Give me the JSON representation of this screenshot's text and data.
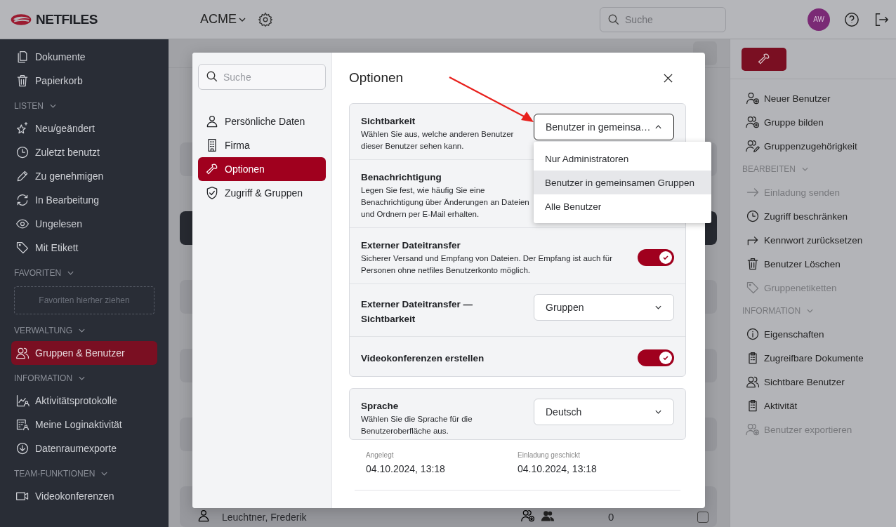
{
  "header": {
    "logo": "NETFILES",
    "workspace": "ACME",
    "search_placeholder": "Suche",
    "avatar": "AW"
  },
  "sidebar": {
    "top_items": [
      {
        "label": "Dokumente",
        "selected": false
      },
      {
        "label": "Papierkorb",
        "selected": false
      }
    ],
    "sections": [
      {
        "title": "LISTEN",
        "items": [
          {
            "label": "Neu/geändert",
            "selected": false
          },
          {
            "label": "Zuletzt benutzt",
            "selected": false
          },
          {
            "label": "Zu genehmigen",
            "selected": false
          },
          {
            "label": "In Bearbeitung",
            "selected": false
          },
          {
            "label": "Ungelesen",
            "selected": false
          },
          {
            "label": "Mit Etikett",
            "selected": false
          }
        ]
      },
      {
        "title": "FAVORITEN",
        "dropzone": "Favoriten hierher ziehen"
      },
      {
        "title": "VERWALTUNG",
        "items": [
          {
            "label": "Gruppen & Benutzer",
            "selected": true
          }
        ]
      },
      {
        "title": "INFORMATION",
        "items": [
          {
            "label": "Aktivitätsprotokolle",
            "selected": false
          },
          {
            "label": "Meine Loginaktivität",
            "selected": false
          },
          {
            "label": "Datenraumexporte",
            "selected": false
          }
        ]
      },
      {
        "title": "TEAM-FUNKTIONEN",
        "items": [
          {
            "label": "Videokonferenzen",
            "selected": false
          }
        ]
      }
    ]
  },
  "list": {
    "rows": [
      {
        "name": "Leuchtner, Frederik",
        "count": "0",
        "checked": false
      }
    ]
  },
  "actions_panel": {
    "top_items": [
      {
        "label": "Neuer Benutzer",
        "disabled": false
      },
      {
        "label": "Gruppe bilden",
        "disabled": false
      },
      {
        "label": "Gruppenzugehörigkeit",
        "disabled": false
      }
    ],
    "sections": [
      {
        "title": "BEARBEITEN",
        "items": [
          {
            "label": "Einladung senden",
            "disabled": true
          },
          {
            "label": "Zugriff beschränken",
            "disabled": false
          },
          {
            "label": "Kennwort zurücksetzen",
            "disabled": false
          },
          {
            "label": "Benutzer Löschen",
            "disabled": false
          },
          {
            "label": "Gruppenetiketten",
            "disabled": true
          }
        ]
      },
      {
        "title": "INFORMATION",
        "items": [
          {
            "label": "Eigenschaften",
            "disabled": false
          },
          {
            "label": "Zugreifbare Dokumente",
            "disabled": false
          },
          {
            "label": "Sichtbare Benutzer",
            "disabled": false
          },
          {
            "label": "Aktivität",
            "disabled": false
          },
          {
            "label": "Benutzer exportieren",
            "disabled": true
          }
        ]
      }
    ]
  },
  "dialog": {
    "search_placeholder": "Suche",
    "nav": [
      {
        "label": "Persönliche Daten",
        "selected": false
      },
      {
        "label": "Firma",
        "selected": false
      },
      {
        "label": "Optionen",
        "selected": true
      },
      {
        "label": "Zugriff & Gruppen",
        "selected": false
      }
    ],
    "title": "Optionen",
    "groups": [
      {
        "settings": [
          {
            "kind": "select",
            "label": "Sichtbarkeit",
            "description": "Wählen Sie aus, welche anderen Benutzer dieser Benutzer sehen kann.",
            "value": "Benutzer in gemeinsa…",
            "expanded": true,
            "options": [
              {
                "label": "Nur Administratoren",
                "selected": false
              },
              {
                "label": "Benutzer in gemeinsamen Gruppen",
                "selected": true
              },
              {
                "label": "Alle Benutzer",
                "selected": false
              }
            ]
          },
          {
            "kind": "text",
            "label": "Benachrichtigung",
            "description": "Legen Sie fest, wie häufig Sie eine Benachrichtigung über Änderungen an Dateien und Ordnern per E-Mail erhalten."
          },
          {
            "kind": "toggle",
            "label": "Externer Dateitransfer",
            "description": "Sicherer Versand und Empfang von Dateien. Der Empfang ist auch für Personen ohne netfiles Benutzerkonto möglich.",
            "on": true
          },
          {
            "kind": "select",
            "label": "Externer Dateitransfer — Sichtbarkeit",
            "value": "Gruppen",
            "expanded": false
          },
          {
            "kind": "toggle",
            "label": "Videokonferenzen erstellen",
            "on": true
          }
        ]
      },
      {
        "settings": [
          {
            "kind": "select",
            "label": "Sprache",
            "description": "Wählen Sie die Sprache für die Benutzeroberfläche aus.",
            "value": "Deutsch",
            "expanded": false
          }
        ]
      }
    ],
    "meta": [
      {
        "label": "Angelegt",
        "value": "04.10.2024, 13:18"
      },
      {
        "label": "Einladung geschickt",
        "value": "04.10.2024, 13:18"
      }
    ]
  }
}
